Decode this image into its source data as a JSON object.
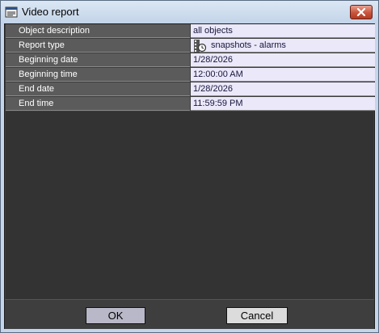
{
  "window": {
    "title": "Video report",
    "icon": "report-window-icon",
    "close_icon": "close-x-icon"
  },
  "properties": [
    {
      "label": "Object description",
      "value": "all objects"
    },
    {
      "label": "Report type",
      "value": "snapshots - alarms",
      "icon": "camera-film-icon"
    },
    {
      "label": "Beginning date",
      "value": "1/28/2026"
    },
    {
      "label": "Beginning time",
      "value": "12:00:00 AM"
    },
    {
      "label": "End date",
      "value": "1/28/2026"
    },
    {
      "label": "End time",
      "value": "11:59:59 PM"
    }
  ],
  "buttons": {
    "ok_label": "OK",
    "cancel_label": "Cancel"
  },
  "colors": {
    "label_bg": "#5b5b5b",
    "value_bg": "#ebe8fa",
    "panel_bg": "#333333",
    "close_red": "#c9543c"
  }
}
